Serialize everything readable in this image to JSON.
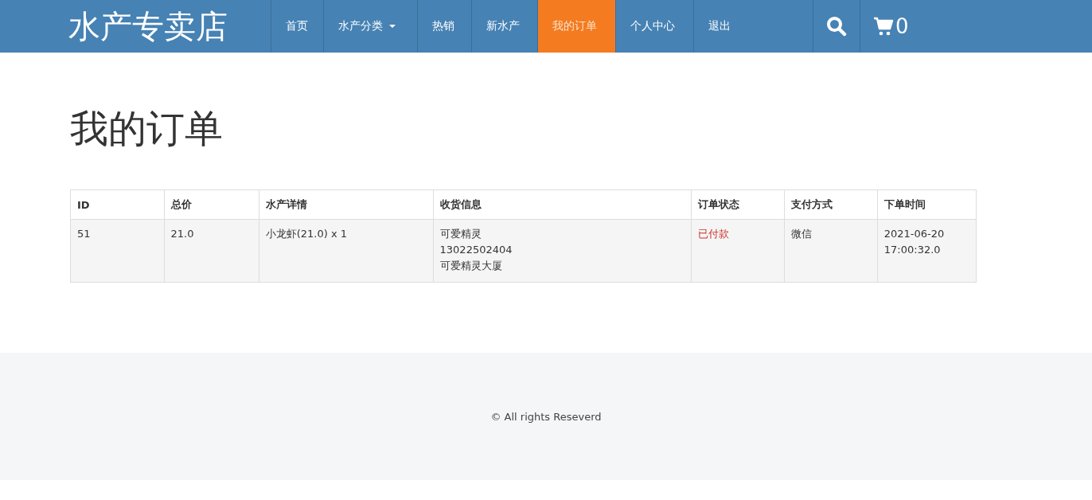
{
  "brand": "水产专卖店",
  "nav": [
    {
      "label": "首页",
      "selected": false,
      "dropdown": false
    },
    {
      "label": "水产分类",
      "selected": false,
      "dropdown": true
    },
    {
      "label": "热销",
      "selected": false,
      "dropdown": false
    },
    {
      "label": "新水产",
      "selected": false,
      "dropdown": false
    },
    {
      "label": "我的订单",
      "selected": true,
      "dropdown": false
    },
    {
      "label": "个人中心",
      "selected": false,
      "dropdown": false
    },
    {
      "label": "退出",
      "selected": false,
      "dropdown": false
    }
  ],
  "cart_count": "0",
  "heading": "我的订单",
  "table": {
    "columns": [
      "ID",
      "总价",
      "水产详情",
      "收货信息",
      "订单状态",
      "支付方式",
      "下单时间"
    ],
    "rows": [
      {
        "cells": [
          {
            "lines": [
              "51"
            ]
          },
          {
            "lines": [
              "21.0"
            ]
          },
          {
            "lines": [
              "小龙虾(21.0) x 1"
            ]
          },
          {
            "lines": [
              "可爱精灵",
              "13022502404",
              "可爱精灵大厦"
            ]
          },
          {
            "lines": [
              "已付款"
            ],
            "kind": "status"
          },
          {
            "lines": [
              "微信"
            ]
          },
          {
            "lines": [
              "2021-06-20",
              "17:00:32.0"
            ]
          }
        ]
      }
    ]
  },
  "footer": "© All rights Reseverd"
}
